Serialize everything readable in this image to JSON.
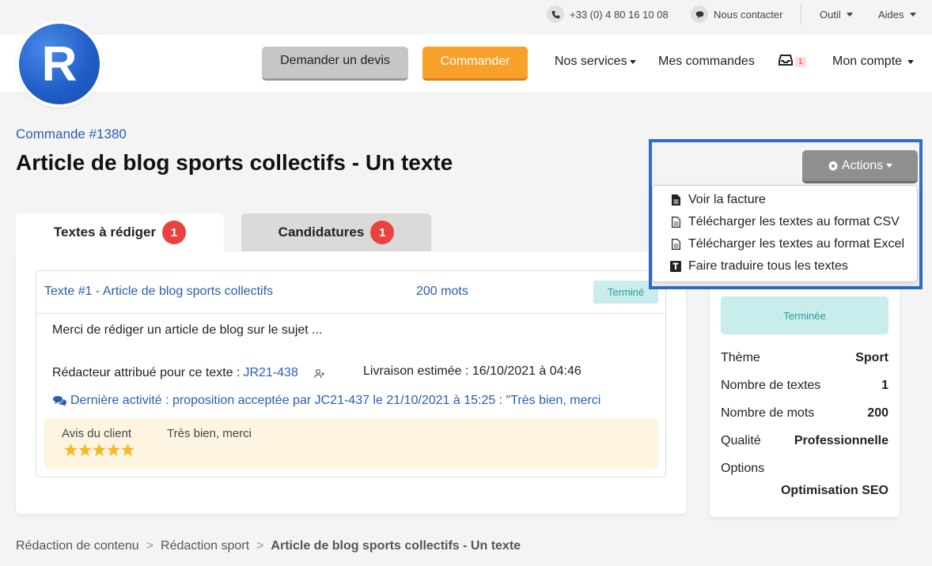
{
  "topbar": {
    "phone": "+33 (0) 4 80 16 10 08",
    "contact": "Nous contacter",
    "tool": "Outil",
    "help": "Aides"
  },
  "header": {
    "logo_letter": "R",
    "quote_button": "Demander un devis",
    "order_button": "Commander",
    "nav_services": "Nos services",
    "nav_orders": "Mes commandes",
    "inbox_count": "1",
    "nav_account": "Mon compte"
  },
  "order": {
    "ref": "Commande #1380",
    "title": "Article de blog sports collectifs - Un texte"
  },
  "tabs": [
    {
      "label": "Textes à rédiger",
      "count": "1"
    },
    {
      "label": "Candidatures",
      "count": "1"
    }
  ],
  "text_card": {
    "title": "Texte #1 - Article de blog sports collectifs",
    "words": "200 mots",
    "status": "Terminé",
    "description": "Merci de rédiger un article de blog sur le sujet ...",
    "writer_label": "Rédacteur attribué pour ce texte :",
    "writer_id": "JR21-438",
    "delivery": "Livraison estimée : 16/10/2021 à 04:46",
    "activity": "Dernière activité : proposition acceptée par JC21-437 le 21/10/2021 à 15:25 : \"Très bien, merci",
    "review_label": "Avis du client",
    "review_text": "Très bien, merci",
    "rating": 5
  },
  "actions": {
    "button": "Actions",
    "items": [
      {
        "label": "Voir la facture",
        "icon": "file-text-icon"
      },
      {
        "label": "Télécharger les textes au format CSV",
        "icon": "file-icon"
      },
      {
        "label": "Télécharger les textes au format Excel",
        "icon": "file-icon"
      },
      {
        "label": "Faire traduire tous les textes",
        "icon": "translate-icon"
      }
    ]
  },
  "summary": {
    "status": "Terminée",
    "rows": [
      {
        "key": "Thème",
        "value": "Sport"
      },
      {
        "key": "Nombre de textes",
        "value": "1"
      },
      {
        "key": "Nombre de mots",
        "value": "200"
      },
      {
        "key": "Qualité",
        "value": "Professionnelle"
      },
      {
        "key": "Options",
        "value": ""
      }
    ],
    "option_value": "Optimisation SEO"
  },
  "breadcrumb": [
    "Rédaction de contenu",
    "Rédaction sport",
    "Article de blog sports collectifs - Un texte"
  ],
  "colors": {
    "brand_blue": "#2a5db0",
    "orange": "#f7a02a",
    "highlight": "#2f6dcb",
    "status_bg": "#c9ecec",
    "badge_red": "#e9433f"
  }
}
